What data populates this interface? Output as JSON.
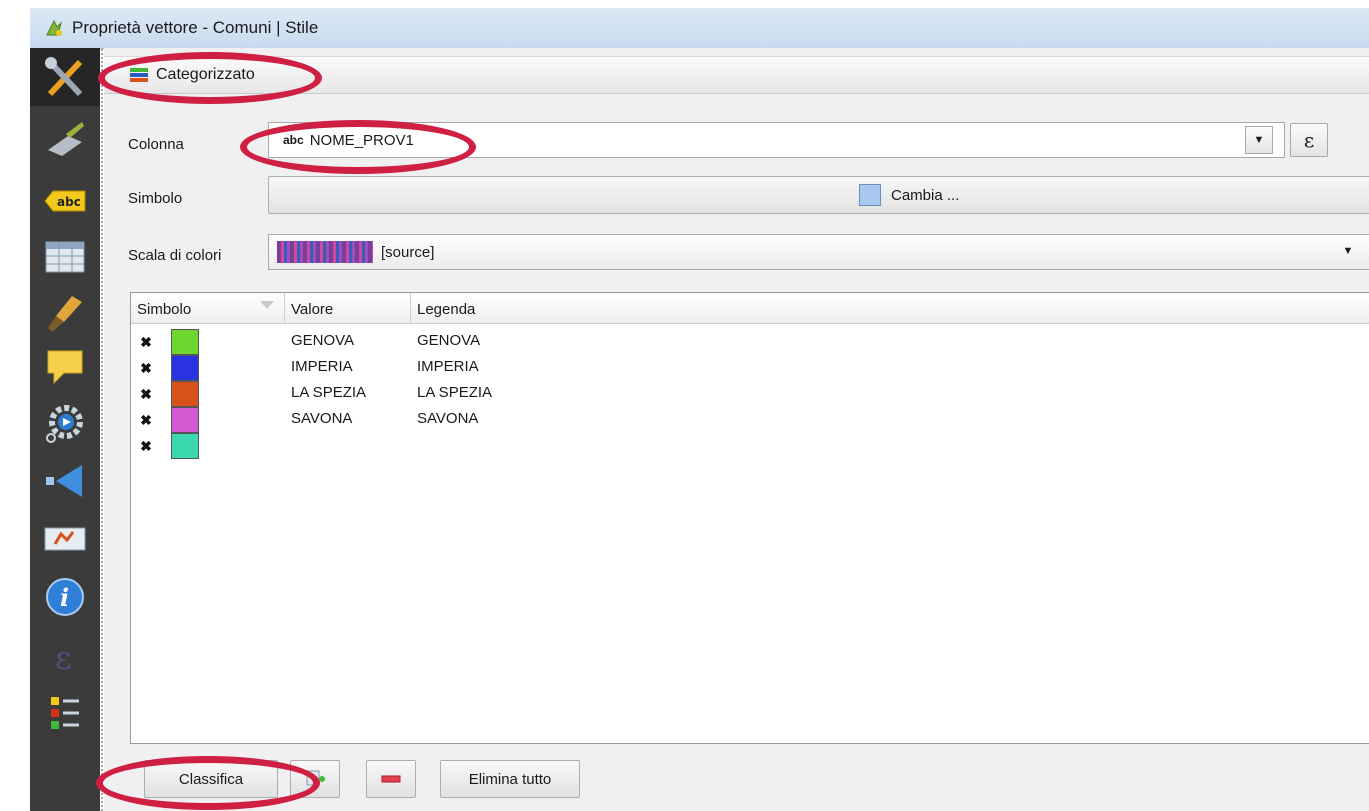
{
  "window": {
    "title": "Proprietà vettore - Comuni | Stile"
  },
  "sidebar": {
    "items": [
      {
        "icon": "general-tools-icon"
      },
      {
        "icon": "style-brush-icon"
      },
      {
        "icon": "labels-abc-icon",
        "label": "abc"
      },
      {
        "icon": "fields-table-icon"
      },
      {
        "icon": "rendering-paintbrush-icon"
      },
      {
        "icon": "display-speechbubble-icon"
      },
      {
        "icon": "actions-gear-icon"
      },
      {
        "icon": "joins-arrow-icon"
      },
      {
        "icon": "diagrams-icon"
      },
      {
        "icon": "metadata-info-icon"
      },
      {
        "icon": "variables-epsilon-icon"
      },
      {
        "icon": "legend-icon"
      }
    ]
  },
  "renderer": {
    "label": "Categorizzato"
  },
  "form": {
    "column_label": "Colonna",
    "column_type_badge": "abc",
    "column_value": "NOME_PROV1",
    "expression_symbol": "ε",
    "symbol_label": "Simbolo",
    "symbol_button": "Cambia ...",
    "ramp_label": "Scala di colori",
    "ramp_value": "[source]"
  },
  "table": {
    "headers": [
      "Simbolo",
      "Valore",
      "Legenda"
    ],
    "rows": [
      {
        "color": "#6ed630",
        "value": "GENOVA",
        "legend": "GENOVA"
      },
      {
        "color": "#2a33e0",
        "value": "IMPERIA",
        "legend": "IMPERIA"
      },
      {
        "color": "#d8501a",
        "value": "LA SPEZIA",
        "legend": "LA SPEZIA"
      },
      {
        "color": "#d45ad4",
        "value": "SAVONA",
        "legend": "SAVONA"
      },
      {
        "color": "#3bd8b0",
        "value": "",
        "legend": ""
      }
    ]
  },
  "buttons": {
    "classify": "Classifica",
    "delete_all": "Elimina tutto"
  },
  "colors": {
    "annotation_red": "#cf1f42",
    "sidebar_bg": "#3b3b3b"
  }
}
